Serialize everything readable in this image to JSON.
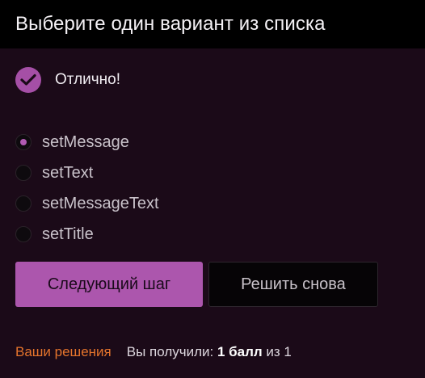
{
  "header": {
    "title": "Выберите один вариант из списка"
  },
  "feedback": {
    "icon": "check-icon",
    "text": "Отлично!",
    "color": "#a54fa6"
  },
  "options": [
    {
      "label": "setMessage",
      "selected": true
    },
    {
      "label": "setText",
      "selected": false
    },
    {
      "label": "setMessageText",
      "selected": false
    },
    {
      "label": "setTitle",
      "selected": false
    }
  ],
  "buttons": {
    "next": "Следующий шаг",
    "retry": "Решить снова"
  },
  "footer": {
    "solutions_link": "Ваши решения",
    "score_prefix": "Вы получили: ",
    "score_value": "1 балл",
    "score_suffix": " из 1"
  },
  "colors": {
    "accent": "#ac56ad",
    "link": "#e5742c",
    "background": "#1b0a18"
  }
}
